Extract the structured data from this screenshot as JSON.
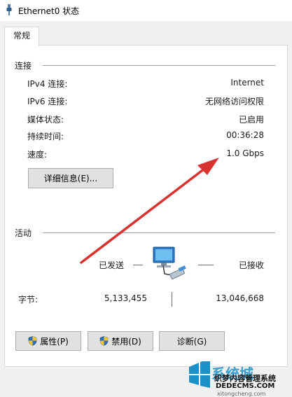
{
  "window": {
    "title": "Ethernet0 状态"
  },
  "tabs": [
    {
      "label": "常规"
    }
  ],
  "connection": {
    "heading": "连接",
    "rows": [
      {
        "label": "IPv4 连接:",
        "value": "Internet"
      },
      {
        "label": "IPv6 连接:",
        "value": "无网络访问权限"
      },
      {
        "label": "媒体状态:",
        "value": "已启用"
      },
      {
        "label": "持续时间:",
        "value": "00:36:28"
      },
      {
        "label": "速度:",
        "value": "1.0 Gbps"
      }
    ],
    "details_button": "详细信息(E)..."
  },
  "activity": {
    "heading": "活动",
    "sent_label": "已发送",
    "received_label": "已接收",
    "bytes_label": "字节:",
    "bytes_sent": "5,133,455",
    "bytes_received": "13,046,668"
  },
  "buttons": {
    "properties": "属性(P)",
    "disable": "禁用(D)",
    "diagnose": "诊断(G)"
  },
  "watermark": {
    "big": "系统城",
    "line1": "织梦内容管理系统",
    "line2": "DEDECMS.COM",
    "line3": "xitongcheng.com"
  },
  "colors": {
    "arrow": "#d8332f",
    "window_bg": "#f0f0f0",
    "panel_bg": "#ffffff",
    "accent": "#1e90c8"
  }
}
